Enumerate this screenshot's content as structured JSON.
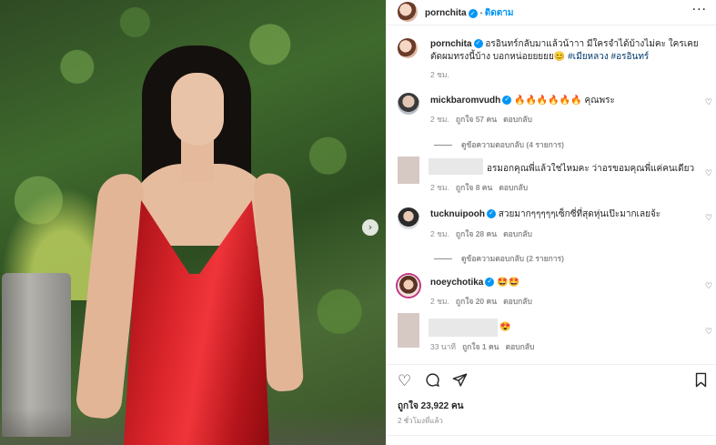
{
  "post": {
    "author": "pornchita",
    "follow_label": "ติดตาม",
    "more_label": "···",
    "caption": {
      "text": "อรอินทร์กลับมาแล้วน้าาา มีใครจำได้บ้างไม่คะ ใครเคยตัดผมทรงนี้บ้าง บอกหน่อยยยยย😊",
      "hashtags": "#เมียหลวง #อรอินทร์",
      "time": "2 ชม."
    }
  },
  "comments": [
    {
      "username": "mickbaromvudh",
      "verified": true,
      "text": "🔥🔥🔥🔥🔥🔥 คุณพระ",
      "time": "2 ชม.",
      "likes": "ถูกใจ 57 คน",
      "reply": "ตอบกลับ",
      "view_replies": "ดูข้อความตอบกลับ (4 รายการ)"
    },
    {
      "username": "",
      "verified": false,
      "text": "อรมอกคุณพี่แล้วใช่ไหมคะ ว่าอรขอมคุณพี่แค่คนเดียว",
      "time": "2 ชม.",
      "likes": "ถูกใจ 8 คน",
      "reply": "ตอบกลับ"
    },
    {
      "username": "tucknuipooh",
      "verified": true,
      "text": "สวยมากๆๆๆๆๆเซ็กซี่ที่สุดหุ่นเป๊ะมากเลยจ้ะ",
      "time": "2 ชม.",
      "likes": "ถูกใจ 28 คน",
      "reply": "ตอบกลับ",
      "view_replies": "ดูข้อความตอบกลับ (2 รายการ)"
    },
    {
      "username": "noeychotika",
      "verified": true,
      "text": "🤩🤩",
      "time": "2 ชม.",
      "likes": "ถูกใจ 20 คน",
      "reply": "ตอบกลับ"
    },
    {
      "username": "",
      "verified": false,
      "text": "😍",
      "time": "33 นาที",
      "likes": "ถูกใจ 1 คน",
      "reply": "ตอบกลับ"
    }
  ],
  "actions": {
    "like_icon": "heart-icon",
    "comment_icon": "comment-icon",
    "share_icon": "send-icon",
    "save_icon": "bookmark-icon"
  },
  "likes_total": "ถูกใจ 23,922 คน",
  "posted_ago": "2 ชั่วโมงที่แล้ว",
  "colors": {
    "link": "#0095f6",
    "hashtag": "#00376b",
    "muted": "#8e8e8e",
    "text": "#262626"
  }
}
